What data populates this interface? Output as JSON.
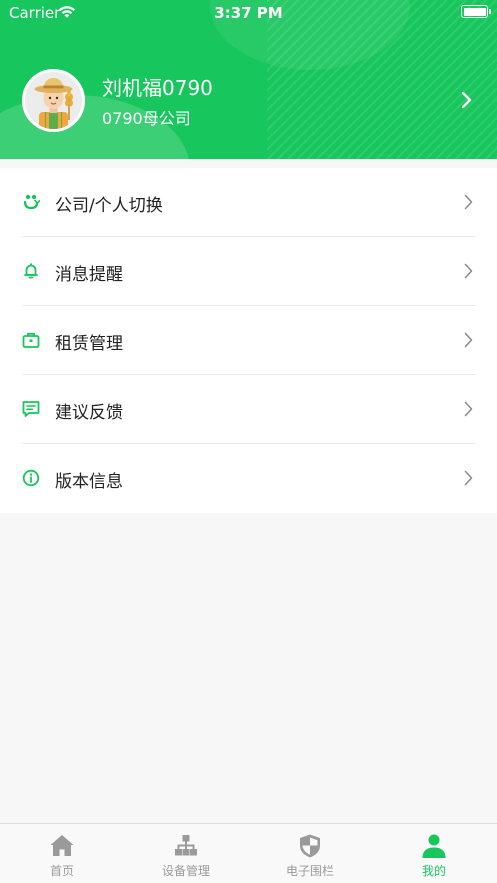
{
  "status_bar": {
    "carrier": "Carrier",
    "time": "3:37 PM"
  },
  "profile": {
    "name": "刘机福0790",
    "company": "0790母公司"
  },
  "menu": [
    {
      "label": "公司/个人切换",
      "icon": "switch-icon"
    },
    {
      "label": "消息提醒",
      "icon": "bell-icon"
    },
    {
      "label": "租赁管理",
      "icon": "briefcase-icon"
    },
    {
      "label": "建议反馈",
      "icon": "feedback-icon"
    },
    {
      "label": "版本信息",
      "icon": "info-icon"
    }
  ],
  "tabs": [
    {
      "label": "首页",
      "icon": "home-icon",
      "active": false
    },
    {
      "label": "设备管理",
      "icon": "hierarchy-icon",
      "active": false
    },
    {
      "label": "电子围栏",
      "icon": "shield-icon",
      "active": false
    },
    {
      "label": "我的",
      "icon": "person-icon",
      "active": true
    }
  ],
  "colors": {
    "brand_green": "#17c65c",
    "tab_inactive": "#9a9a9a",
    "text": "#222222"
  }
}
